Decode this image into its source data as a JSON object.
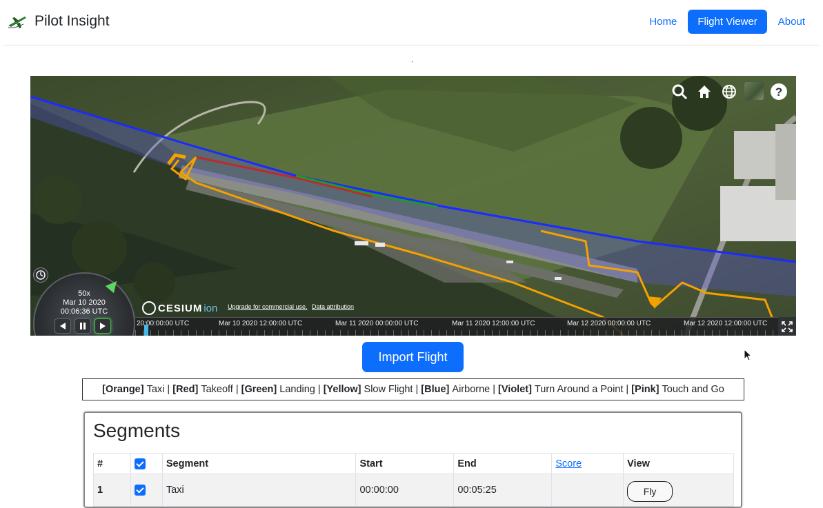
{
  "navbar": {
    "brand": "Pilot Insight",
    "links": [
      {
        "label": "Home",
        "active": false
      },
      {
        "label": "Flight Viewer",
        "active": true
      },
      {
        "label": "About",
        "active": false
      }
    ]
  },
  "stray_mark": "`",
  "viewer": {
    "toolbar_icons": [
      "search-icon",
      "home-icon",
      "globe-icon",
      "imagery-layer-icon",
      "help-icon"
    ],
    "animation": {
      "speed": "50x",
      "date": "Mar 10 2020",
      "time": "00:06:36 UTC"
    },
    "credits": {
      "logo_word": "CESIUM",
      "logo_suffix": "ion",
      "upgrade": "Upgrade for commercial use.",
      "attribution": "Data attribution"
    },
    "timeline_labels": [
      "20:00:00:00 UTC",
      "Mar 10 2020 12:00:00 UTC",
      "Mar 11 2020 00:00:00 UTC",
      "Mar 11 2020 12:00:00 UTC",
      "Mar 12 2020 00:00:00 UTC",
      "Mar 12 2020 12:00:00 UTC"
    ],
    "track_colors": {
      "taxi": "#f5a100",
      "takeoff": "#cc2222",
      "landing": "#1f9a2a",
      "airborne": "#1a2bff"
    }
  },
  "import_button": "Import Flight",
  "legend": [
    {
      "tag": "[Orange]",
      "label": "Taxi"
    },
    {
      "tag": "[Red]",
      "label": "Takeoff"
    },
    {
      "tag": "[Green]",
      "label": "Landing"
    },
    {
      "tag": "[Yellow]",
      "label": "Slow Flight"
    },
    {
      "tag": "[Blue]",
      "label": "Airborne"
    },
    {
      "tag": "[Violet]",
      "label": "Turn Around a Point"
    },
    {
      "tag": "[Pink]",
      "label": "Touch and Go"
    }
  ],
  "segments": {
    "title": "Segments",
    "headers": {
      "num": "#",
      "segment": "Segment",
      "start": "Start",
      "end": "End",
      "score": "Score",
      "view": "View"
    },
    "rows": [
      {
        "num": "1",
        "segment": "Taxi",
        "start": "00:00:00",
        "end": "00:05:25",
        "score": "",
        "view": "Fly"
      }
    ]
  }
}
